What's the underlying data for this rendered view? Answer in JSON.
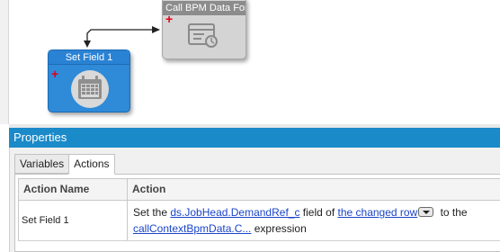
{
  "workflow": {
    "bpm_node": {
      "title": "Call BPM Data Form",
      "plus": "+",
      "icon": "form-gear-icon"
    },
    "set_field_node": {
      "title": "Set Field 1",
      "plus": "+",
      "icon": "calendar-icon"
    }
  },
  "properties": {
    "header": "Properties",
    "tabs": [
      {
        "label": "Variables",
        "active": false
      },
      {
        "label": "Actions",
        "active": true
      }
    ],
    "grid": {
      "columns": [
        "Action Name",
        "Action"
      ],
      "rows": [
        {
          "name": "Set Field 1",
          "text_set_the": "Set the ",
          "field_link": "ds.JobHead.DemandRef_c",
          "text_field_of": " field of ",
          "row_link": "the changed row",
          "text_to_the": " to the",
          "expr_link": "callContextBpmData.C...",
          "text_expression": " expression"
        }
      ]
    }
  },
  "colors": {
    "properties_header": "#1b8ac9",
    "set_field_node": "#2f8ad8",
    "bpm_node": "#d4d4d4",
    "link": "#1a45c8",
    "plus": "#e0001a"
  }
}
